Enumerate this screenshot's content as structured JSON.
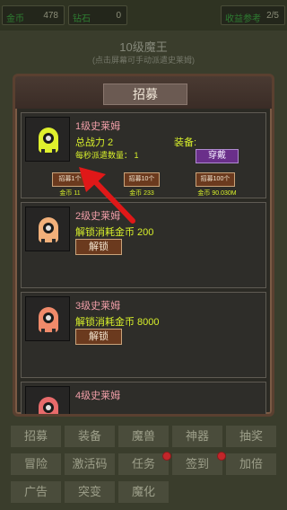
{
  "topbar": {
    "stat1": {
      "label": "金币",
      "value": "478"
    },
    "stat2": {
      "label": "钻石",
      "value": "0"
    },
    "stat3": {
      "label": "收益参考",
      "value": "2/5"
    }
  },
  "stage": {
    "title": "10级魔王",
    "subtitle": "(点击屏幕可手动派遣史莱姆)"
  },
  "panel": {
    "title": "招募",
    "cards": [
      {
        "name": "1级史莱姆",
        "power": "总战力 2",
        "rate": "每秒派遣数量：  1",
        "equip_label": "装备:",
        "equip_button": "穿戴",
        "recruit": [
          {
            "label": "招募1个",
            "cost": "金币 11"
          },
          {
            "label": "招募10个",
            "cost": "金币 233"
          },
          {
            "label": "招募100个",
            "cost": "金币 90.030M"
          }
        ],
        "slime_color": "#dff02d"
      },
      {
        "name": "2级史莱姆",
        "unlock_cost": "解锁消耗金币  200",
        "unlock_button": "解锁",
        "slime_color": "#f2b07a"
      },
      {
        "name": "3级史莱姆",
        "unlock_cost": "解锁消耗金币  8000",
        "unlock_button": "解锁",
        "slime_color": "#f08a6a"
      },
      {
        "name": "4级史莱姆",
        "slime_color": "#e86b6b"
      }
    ]
  },
  "menu": {
    "row1": [
      "招募",
      "装备",
      "魔兽",
      "神器",
      "抽奖"
    ],
    "row2": [
      "冒险",
      "激活码",
      "任务",
      "签到",
      "加倍"
    ],
    "row3": [
      "广告",
      "突变",
      "魔化"
    ]
  },
  "colors": {
    "accent_text": "#d7ef2a",
    "name_text": "#f09ea8",
    "equip_button": "#6a2f8a",
    "action_button": "#6b3a1e",
    "notification": "#c3262a",
    "tutorial_arrow": "#e01818"
  },
  "icons": {
    "slime": "slime-icon",
    "arrow": "tutorial-arrow-icon",
    "badge": "notification-dot-icon"
  }
}
